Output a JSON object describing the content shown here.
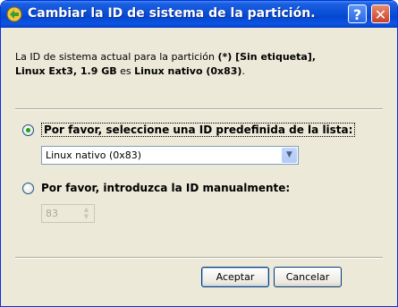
{
  "window": {
    "title": "Cambiar la ID de sistema de la partición.",
    "help_label": "?",
    "close_label": "✕"
  },
  "description": {
    "line1_prefix": "La ID de sistema actual para la partición ",
    "partition": "(*) [Sin etiqueta],",
    "line2_fs": "Linux Ext3, 1.9 GB",
    "line2_mid": " es ",
    "current_id": "Linux nativo (0x83)",
    "line2_end": "."
  },
  "options": {
    "predefined_label": "Por favor, seleccione una ID predefinida de la lista:",
    "predefined_selected": true,
    "manual_label": "Por favor, introduzca la ID manualmente:",
    "manual_selected": false
  },
  "select": {
    "value": "Linux nativo (0x83)"
  },
  "manual_id": {
    "value": "83"
  },
  "buttons": {
    "ok": "Aceptar",
    "cancel": "Cancelar"
  },
  "colors": {
    "titlebar": "#0a4fd7",
    "face": "#ece9d8",
    "radio_dot": "#21a121"
  },
  "icons": {
    "app": "partition-app-icon",
    "help": "help-icon",
    "close": "close-icon"
  }
}
